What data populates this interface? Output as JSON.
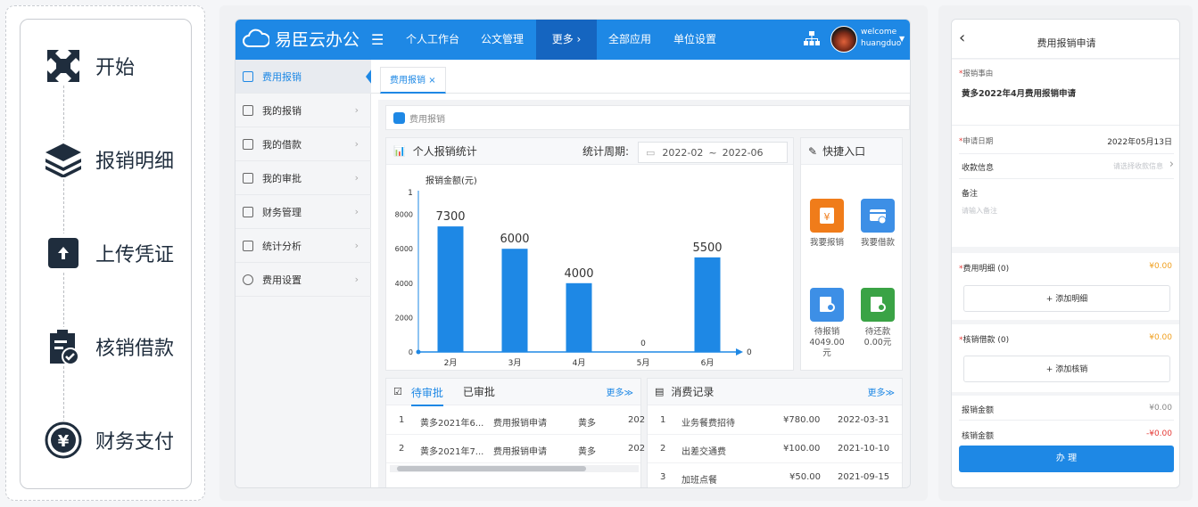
{
  "flow": {
    "steps": [
      {
        "label": "开始",
        "icon": "expand-icon"
      },
      {
        "label": "报销明细",
        "icon": "layers-icon"
      },
      {
        "label": "上传凭证",
        "icon": "upload-icon"
      },
      {
        "label": "核销借款",
        "icon": "clipboard-check-icon"
      },
      {
        "label": "财务支付",
        "icon": "yen-circle-icon"
      }
    ]
  },
  "app": {
    "brand": "易臣云办公",
    "nav": [
      "个人工作台",
      "公文管理",
      "更多 ›",
      "全部应用",
      "单位设置"
    ],
    "user": {
      "greeting": "welcome",
      "name": "huangduo"
    },
    "sidebar": [
      {
        "label": "费用报销"
      },
      {
        "label": "我的报销"
      },
      {
        "label": "我的借款"
      },
      {
        "label": "我的审批"
      },
      {
        "label": "财务管理"
      },
      {
        "label": "统计分析"
      },
      {
        "label": "费用设置"
      }
    ],
    "tab": {
      "label": "费用报销",
      "close": "×"
    },
    "breadcrumb": "费用报销",
    "stats": {
      "title": "个人报销统计",
      "period_label": "统计周期:",
      "period_from": "2022-02",
      "period_sep": "~",
      "period_to": "2022-06"
    },
    "quick": {
      "title": "快捷入口",
      "items": [
        {
          "label": "我要报销",
          "color": "#f07c1a"
        },
        {
          "label": "我要借款",
          "color": "#3d8fe6"
        },
        {
          "label": "待报销\n4049.00\n元",
          "color": "#3d8fe6"
        },
        {
          "label": "待还款\n0.00元",
          "color": "#3aa345"
        }
      ]
    },
    "pending": {
      "tab_active": "待审批",
      "tab_other": "已审批",
      "more": "更多≫",
      "rows": [
        {
          "no": "1",
          "title": "黄多2021年6...",
          "type": "费用报销申请",
          "user": "黄多",
          "date": "202"
        },
        {
          "no": "2",
          "title": "黄多2021年7...",
          "type": "费用报销申请",
          "user": "黄多",
          "date": "202"
        }
      ]
    },
    "records": {
      "title": "消费记录",
      "more": "更多≫",
      "rows": [
        {
          "no": "1",
          "name": "业务餐费招待",
          "amount": "¥780.00",
          "date": "2022-03-31"
        },
        {
          "no": "2",
          "name": "出差交通费",
          "amount": "¥100.00",
          "date": "2021-10-10"
        },
        {
          "no": "3",
          "name": "加班点餐",
          "amount": "¥50.00",
          "date": "2021-09-15"
        }
      ]
    }
  },
  "chart_data": {
    "type": "bar",
    "title": "",
    "ylabel": "报销金额(元)",
    "xlabel": "",
    "categories": [
      "2月",
      "3月",
      "4月",
      "5月",
      "6月"
    ],
    "values": [
      7300,
      6000,
      4000,
      0,
      5500
    ],
    "yticks": [
      0,
      2000,
      4000,
      6000,
      8000
    ],
    "ytop_label": "1",
    "xend_label": "0",
    "ylim": [
      0,
      10000
    ],
    "color": "#1e88e5"
  },
  "mobile": {
    "title": "费用报销申请",
    "back": "‹",
    "reason_label": "报销事由",
    "reason_value": "黄多2022年4月费用报销申请",
    "date_label": "申请日期",
    "date_value": "2022年05月13日",
    "payee_label": "收款信息",
    "payee_placeholder": "请选择收款信息",
    "note_label": "备注",
    "note_placeholder": "请输入备注",
    "detail_label": "费用明细 (0)",
    "detail_amount": "¥0.00",
    "add_detail": "+ 添加明细",
    "loan_label": "核销借款 (0)",
    "loan_amount": "¥0.00",
    "add_loan": "+ 添加核销",
    "total_label": "报销金额",
    "total_value": "¥0.00",
    "writeoff_label": "核销金额",
    "writeoff_value": "-¥0.00",
    "submit": "办 理",
    "accent": "#1e88e5",
    "warn": "#f0a020"
  }
}
